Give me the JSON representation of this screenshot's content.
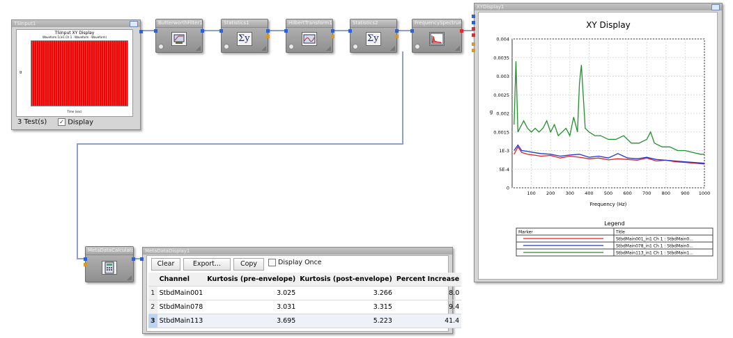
{
  "nodes": {
    "tsinput": {
      "title": "TSInput1",
      "plot_title": "TSInput XY Display",
      "plot_subtitle": "Waveform 1(in1 Ch 1 · Waveform · Waveform)",
      "x_label": "Time (sec)",
      "y_label": "g",
      "test_count": "3 Test(s)",
      "display_checked": true,
      "display_label": "Display"
    },
    "butterworth": {
      "title": "ButterworthFilter1"
    },
    "statistics1": {
      "title": "Statistics1",
      "icon": "sigma-icon",
      "glyph": "Σy"
    },
    "hilbert": {
      "title": "HilbertTransform1"
    },
    "statistics2": {
      "title": "Statistics2",
      "icon": "sigma-icon",
      "glyph": "Σy"
    },
    "frequency_spectrum": {
      "title": "FrequencySpectrum1"
    },
    "metadata_calculator": {
      "title": "MetaDataCalculator1"
    }
  },
  "xy_display": {
    "title": "XYDisplay1",
    "chart_data": {
      "type": "line",
      "title": "XY Display",
      "xlabel": "Frequency (Hz)",
      "ylabel": "g",
      "xlim": [
        0,
        1000
      ],
      "ylim": [
        0,
        0.004
      ],
      "x_ticks": [
        100,
        200,
        300,
        400,
        500,
        600,
        700,
        800,
        900,
        1000
      ],
      "y_tick_labels": [
        "0",
        "5E-4",
        "1E-3",
        "0.0015",
        "0.002",
        "0.0025",
        "0.003",
        "0.0035",
        "0.004"
      ],
      "y_ticks": [
        0,
        0.0005,
        0.001,
        0.0015,
        0.002,
        0.0025,
        0.003,
        0.0035,
        0.004
      ],
      "grid": true,
      "legend": {
        "title": "Legend",
        "headers": [
          "Marker",
          "Title"
        ],
        "entries": [
          {
            "color": "#e02020",
            "label": "StbdMain001_in1 Ch 1 : StbdMain0..."
          },
          {
            "color": "#2030e0",
            "label": "StbdMain078_in1 Ch 1 : StbdMain0..."
          },
          {
            "color": "#20902a",
            "label": "StbdMain113_in1 Ch 1 : StbdMain1..."
          }
        ]
      },
      "series": [
        {
          "name": "StbdMain001_in1 Ch 1 : StbdMain0...",
          "color": "#e02020",
          "x": [
            10,
            30,
            50,
            80,
            110,
            150,
            200,
            250,
            300,
            350,
            400,
            450,
            500,
            550,
            600,
            650,
            700,
            750,
            800,
            850,
            900,
            950,
            1000
          ],
          "y": [
            0.0009,
            0.0011,
            0.00095,
            0.0009,
            0.00088,
            0.00085,
            0.00087,
            0.0008,
            0.00085,
            0.00082,
            0.00078,
            0.0008,
            0.00075,
            0.00078,
            0.00076,
            0.00074,
            0.0008,
            0.00072,
            0.00074,
            0.0007,
            0.00068,
            0.00066,
            0.00064
          ]
        },
        {
          "name": "StbdMain078_in1 Ch 1 : StbdMain0...",
          "color": "#2030e0",
          "x": [
            10,
            30,
            50,
            80,
            110,
            150,
            200,
            250,
            300,
            350,
            400,
            450,
            500,
            550,
            600,
            650,
            700,
            750,
            800,
            850,
            900,
            950,
            1000
          ],
          "y": [
            0.001,
            0.00115,
            0.001,
            0.00098,
            0.00095,
            0.00092,
            0.0009,
            0.00085,
            0.00088,
            0.0009,
            0.00082,
            0.00085,
            0.0008,
            0.00092,
            0.0008,
            0.00078,
            0.00082,
            0.00076,
            0.00074,
            0.00072,
            0.0007,
            0.00068,
            0.00066
          ]
        },
        {
          "name": "StbdMain113_in1 Ch 1 : StbdMain1...",
          "color": "#20902a",
          "x": [
            10,
            20,
            30,
            40,
            60,
            80,
            100,
            120,
            140,
            160,
            180,
            200,
            220,
            240,
            260,
            280,
            300,
            320,
            340,
            350,
            360,
            380,
            400,
            430,
            460,
            500,
            540,
            580,
            620,
            660,
            700,
            720,
            740,
            780,
            820,
            860,
            900,
            940,
            980,
            1000
          ],
          "y": [
            0.0017,
            0.0034,
            0.0015,
            0.0016,
            0.0018,
            0.0016,
            0.0015,
            0.0016,
            0.0015,
            0.0016,
            0.0018,
            0.0015,
            0.0017,
            0.0014,
            0.0015,
            0.0016,
            0.0014,
            0.0019,
            0.0015,
            0.0028,
            0.0033,
            0.0016,
            0.0015,
            0.0014,
            0.0014,
            0.0013,
            0.0013,
            0.0014,
            0.0012,
            0.0012,
            0.0013,
            0.0015,
            0.0012,
            0.0011,
            0.0011,
            0.001,
            0.001,
            0.00095,
            0.0009,
            0.0009
          ]
        }
      ]
    }
  },
  "metadata_display": {
    "title": "MetaDataDisplay1",
    "toolbar": {
      "clear_label": "Clear",
      "export_label": "Export...",
      "copy_label": "Copy",
      "display_once_label": "Display Once",
      "display_once_checked": false
    },
    "table": {
      "headers": [
        "Channel",
        "Kurtosis (pre-envelope)",
        "Kurtosis (post-envelope)",
        "Percent Increase"
      ],
      "rows": [
        {
          "n": "1",
          "channel": "StbdMain001",
          "pre": "3.025",
          "post": "3.266",
          "pct": "8.0"
        },
        {
          "n": "2",
          "channel": "StbdMain078",
          "pre": "3.031",
          "post": "3.315",
          "pct": "9.4"
        },
        {
          "n": "3",
          "channel": "StbdMain113",
          "pre": "3.695",
          "post": "5.223",
          "pct": "41.4"
        }
      ]
    }
  }
}
